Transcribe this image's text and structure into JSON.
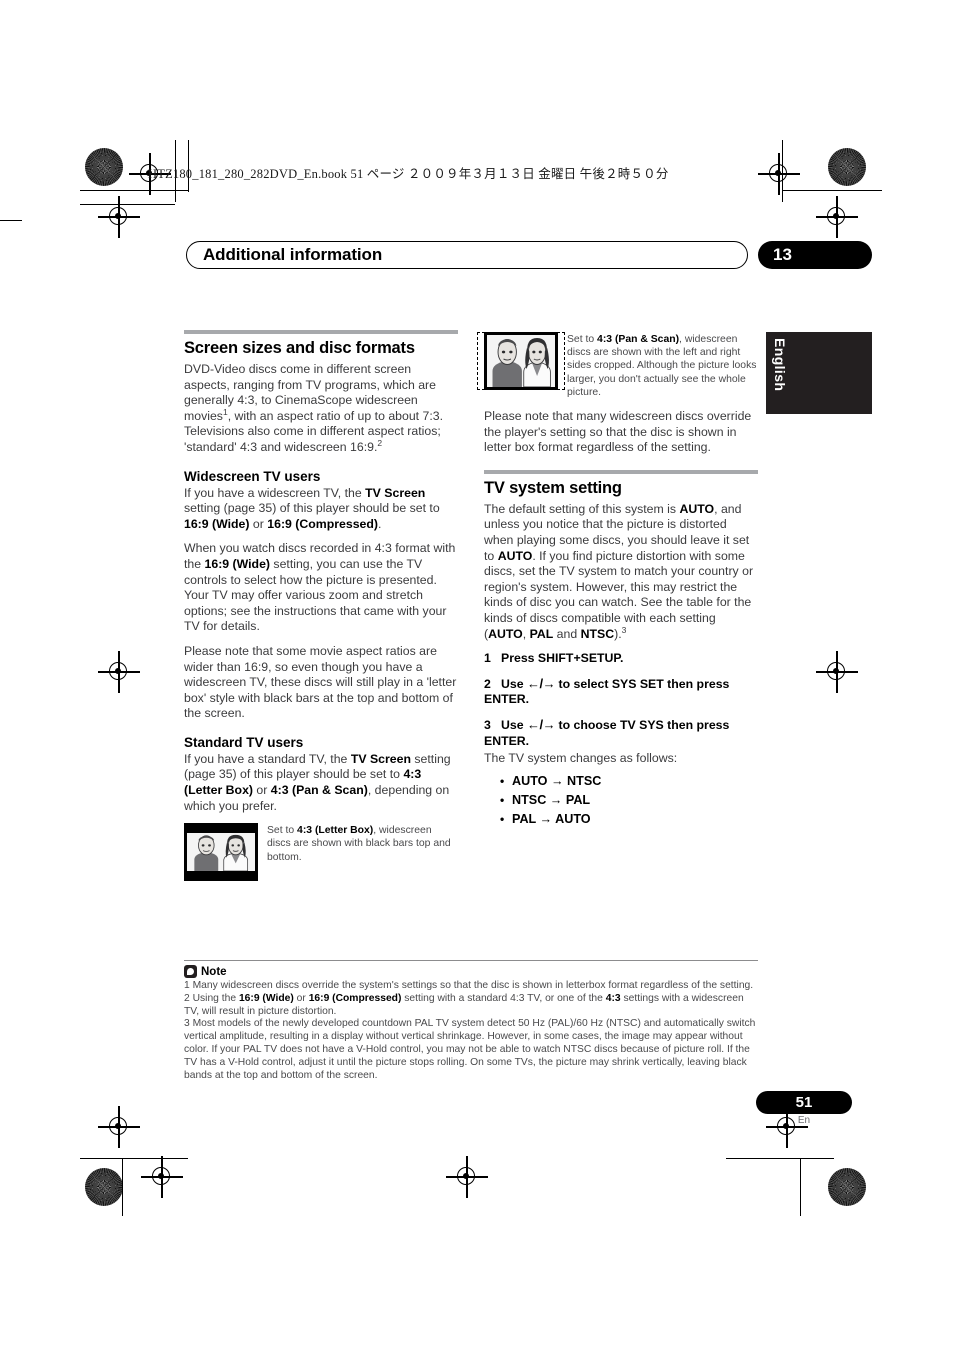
{
  "book_header": "HTZ180_181_280_282DVD_En.book   51 ページ   ２００９年３月１３日   金曜日   午後２時５０分",
  "chapter": {
    "title": "Additional information",
    "number": "13"
  },
  "language_tab": "English",
  "left_column": {
    "section_title": "Screen sizes and disc formats",
    "intro_paragraph": {
      "part1": "DVD-Video discs come in different screen aspects, ranging from TV programs, which are generally 4:3, to CinemaScope widescreen movies",
      "sup1": "1",
      "part2": ", with an aspect ratio of up to about 7:3. Televisions also come in different aspect ratios; 'standard' 4:3 and widescreen 16:9.",
      "sup2": "2"
    },
    "widescreen_heading": "Widescreen TV users",
    "widescreen_p1": {
      "t1": "If you have a widescreen TV, the ",
      "b1": "TV Screen",
      "t2": " setting (page 35) of this player should be set to ",
      "b2": "16:9 (Wide)",
      "t3": " or ",
      "b3": "16:9 (Compressed)",
      "t4": "."
    },
    "widescreen_p2": {
      "t1": "When you watch discs recorded in 4:3 format with the ",
      "b1": "16:9 (Wide)",
      "t2": " setting, you can use the TV controls to select how the picture is presented. Your TV may offer various zoom and stretch options; see the instructions that came with your TV for details."
    },
    "widescreen_p3": "Please note that some movie aspect ratios are wider than 16:9, so even though you have a widescreen TV, these discs will still play in a 'letter box' style with black bars at the top and bottom of the screen.",
    "standard_heading": "Standard TV users",
    "standard_p1": {
      "t1": "If you have a standard TV, the ",
      "b1": "TV Screen",
      "t2": " setting (page 35) of this player should be set to ",
      "b2": "4:3 (Letter Box)",
      "t3": " or ",
      "b3": "4:3 (Pan & Scan)",
      "t4": ", depending on which you prefer."
    },
    "letterbox_figure_caption": {
      "t1": "Set to ",
      "b1": "4:3 (Letter Box)",
      "t2": ", widescreen discs are shown with black bars top and bottom."
    }
  },
  "right_column": {
    "panscan_figure_caption": {
      "t1": "Set to ",
      "b1": "4:3 (Pan & Scan)",
      "t2": ", widescreen discs are shown with the left and right sides cropped. Although the picture looks larger, you don't actually see the whole picture."
    },
    "override_paragraph": "Please note that many widescreen discs override the player's setting so that the disc is shown in letter box format regardless of the setting.",
    "section_title": "TV system setting",
    "tvsystem_paragraph": {
      "t1": "The default setting of this system is ",
      "b1": "AUTO",
      "t2": ", and unless you notice that the picture is distorted when playing some discs, you should leave it set to ",
      "b2": "AUTO",
      "t3": ". If you find picture distortion with some discs, set the TV system to match your country or region's system. However, this may restrict the kinds of disc you can watch. See the table for the kinds of discs compatible with each setting (",
      "b3": "AUTO",
      "t4": ", ",
      "b4": "PAL",
      "t5": " and ",
      "b5": "NTSC",
      "t6": ").",
      "sup": "3"
    },
    "steps": [
      {
        "num": "1",
        "text": "Press SHIFT+SETUP.",
        "arrows": ""
      },
      {
        "num": "2",
        "pre": "Use ",
        "arrows": "←/→",
        "post": " to select SYS SET then press ENTER."
      },
      {
        "num": "3",
        "pre": "Use ",
        "arrows": "←/→",
        "post": " to choose TV SYS then press ENTER."
      }
    ],
    "changes_lead": "The TV system changes as follows:",
    "changes_list": [
      "AUTO → NTSC",
      "NTSC → PAL",
      "PAL → AUTO"
    ]
  },
  "notes": {
    "label": "Note",
    "footnote1": "1 Many widescreen discs override the system's settings so that the disc is shown in letterbox format regardless of the setting.",
    "footnote2": {
      "t1": "2 Using the ",
      "b1": "16:9 (Wide)",
      "t2": " or ",
      "b2": "16:9 (Compressed)",
      "t3": " setting with a standard 4:3 TV, or one of the ",
      "b3": "4:3",
      "t4": " settings with a widescreen TV, will result in picture distortion."
    },
    "footnote3": "3 Most models of the newly developed countdown PAL TV system detect 50 Hz (PAL)/60 Hz (NTSC) and automatically switch vertical amplitude, resulting in a display without vertical shrinkage. However, in some cases, the image may appear without color. If your PAL TV does not have a V-Hold control, you may not be able to watch NTSC discs because of picture roll. If the TV has a V-Hold control, adjust it until the picture stops rolling. On some TVs, the picture may shrink vertically, leaving black bands at the top and bottom of the screen."
  },
  "footer": {
    "page_number": "51",
    "language_code": "En"
  }
}
